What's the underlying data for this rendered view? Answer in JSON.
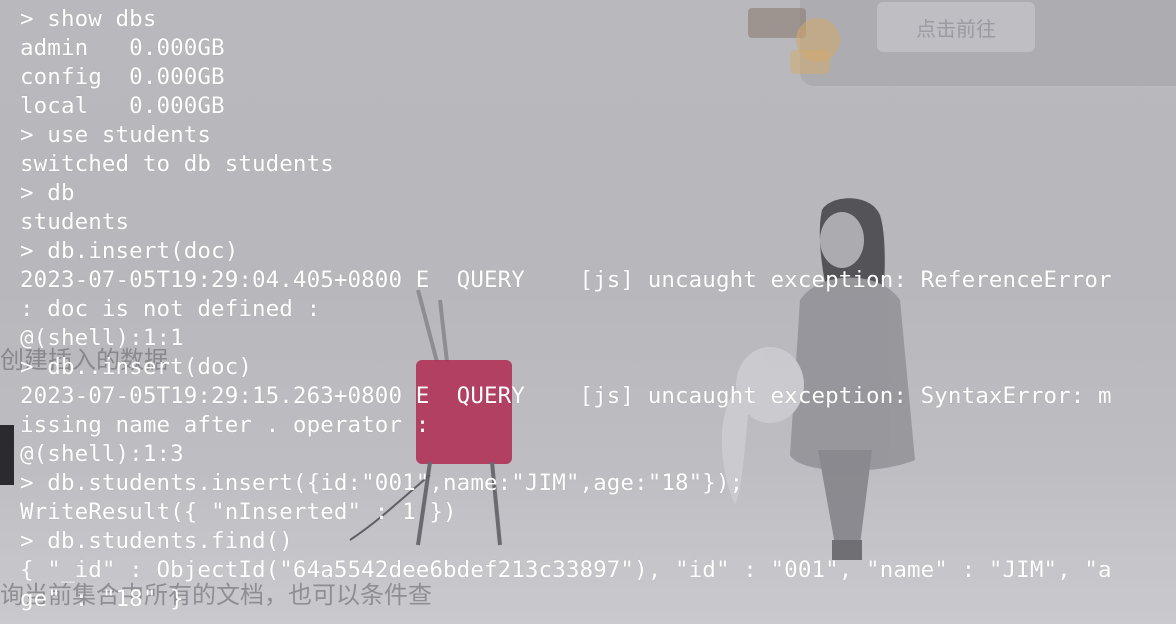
{
  "banner": {
    "button_label": "点击前往"
  },
  "background": {
    "ghost_text_1": "创建插入的数据",
    "ghost_text_2": "询当前集合中所有的文档，也可以条件查"
  },
  "terminal": {
    "lines": [
      "> show dbs",
      "admin   0.000GB",
      "config  0.000GB",
      "local   0.000GB",
      "> use students",
      "switched to db students",
      "> db",
      "students",
      "> db.insert(doc)",
      "2023-07-05T19:29:04.405+0800 E  QUERY    [js] uncaught exception: ReferenceError",
      ": doc is not defined :",
      "@(shell):1:1",
      "> db..insert(doc)",
      "2023-07-05T19:29:15.263+0800 E  QUERY    [js] uncaught exception: SyntaxError: m",
      "issing name after . operator :",
      "@(shell):1:3",
      "> db.students.insert({id:\"001\",name:\"JIM\",age:\"18\"});",
      "WriteResult({ \"nInserted\" : 1 })",
      "> db.students.find()",
      "{ \"_id\" : ObjectId(\"64a5542dee6bdef213c33897\"), \"id\" : \"001\", \"name\" : \"JIM\", \"a",
      "ge\" : \"18\" }"
    ]
  },
  "colors": {
    "terminal_text": "#ffffff",
    "tv_body": "#b02a52",
    "background": "#b9b9bd"
  }
}
